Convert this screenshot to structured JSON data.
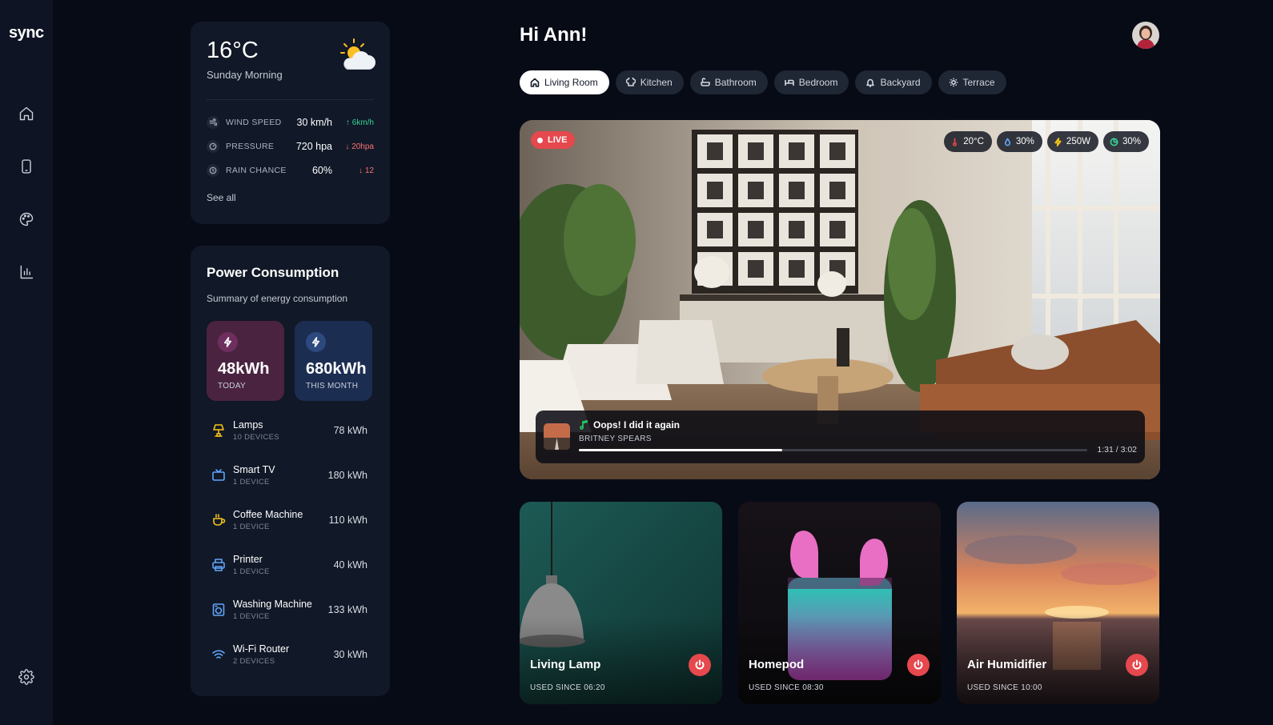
{
  "app": {
    "logo": "sync"
  },
  "greeting": "Hi Ann!",
  "weather": {
    "temperature": "16°C",
    "time_of_day": "Sunday Morning",
    "rows": [
      {
        "label": "WIND SPEED",
        "value": "30 km/h",
        "delta": "6km/h",
        "trend": "up"
      },
      {
        "label": "PRESSURE",
        "value": "720 hpa",
        "delta": "20hpa",
        "trend": "down"
      },
      {
        "label": "RAIN CHANCE",
        "value": "60%",
        "delta": "12",
        "trend": "down"
      }
    ],
    "see_all": "See all"
  },
  "power": {
    "title": "Power Consumption",
    "subtitle": "Summary of energy consumption",
    "today": {
      "value": "48kWh",
      "label": "TODAY"
    },
    "month": {
      "value": "680kWh",
      "label": "THIS MONTH"
    },
    "devices": [
      {
        "name": "Lamps",
        "count": "10 DEVICES",
        "kwh": "78 kWh",
        "icon": "lamp-icon",
        "color": "#f5c518"
      },
      {
        "name": "Smart TV",
        "count": "1 DEVICE",
        "kwh": "180 kWh",
        "icon": "tv-icon",
        "color": "#60a5fa"
      },
      {
        "name": "Coffee Machine",
        "count": "1 DEVICE",
        "kwh": "110 kWh",
        "icon": "coffee-icon",
        "color": "#f5c518"
      },
      {
        "name": "Printer",
        "count": "1 DEVICE",
        "kwh": "40 kWh",
        "icon": "printer-icon",
        "color": "#60a5fa"
      },
      {
        "name": "Washing Machine",
        "count": "1 DEVICE",
        "kwh": "133 kWh",
        "icon": "washing-machine-icon",
        "color": "#60a5fa"
      },
      {
        "name": "Wi-Fi Router",
        "count": "2 DEVICES",
        "kwh": "30 kWh",
        "icon": "wifi-icon",
        "color": "#60a5fa"
      }
    ]
  },
  "rooms": [
    {
      "label": "Living Room",
      "active": true,
      "icon": "home-icon"
    },
    {
      "label": "Kitchen",
      "active": false,
      "icon": "chef-hat-icon"
    },
    {
      "label": "Bathroom",
      "active": false,
      "icon": "bathtub-icon"
    },
    {
      "label": "Bedroom",
      "active": false,
      "icon": "bed-icon"
    },
    {
      "label": "Backyard",
      "active": false,
      "icon": "bell-icon"
    },
    {
      "label": "Terrace",
      "active": false,
      "icon": "sun-icon"
    }
  ],
  "camera": {
    "live_label": "LIVE",
    "stats": [
      {
        "value": "20°C",
        "icon": "thermometer-icon",
        "color": "#ef4444"
      },
      {
        "value": "30%",
        "icon": "humidity-icon",
        "color": "#60a5fa"
      },
      {
        "value": "250W",
        "icon": "bolt-icon",
        "color": "#facc15"
      },
      {
        "value": "30%",
        "icon": "pie-icon",
        "color": "#34d399"
      }
    ],
    "player": {
      "song": "Oops! I did it again",
      "artist": "BRITNEY SPEARS",
      "time": "1:31 / 3:02",
      "progress": 0.4
    }
  },
  "devices": [
    {
      "title": "Living Lamp",
      "since": "USED SINCE 06:20"
    },
    {
      "title": "Homepod",
      "since": "USED SINCE 08:30"
    },
    {
      "title": "Air Humidifier",
      "since": "USED SINCE 10:00"
    }
  ]
}
